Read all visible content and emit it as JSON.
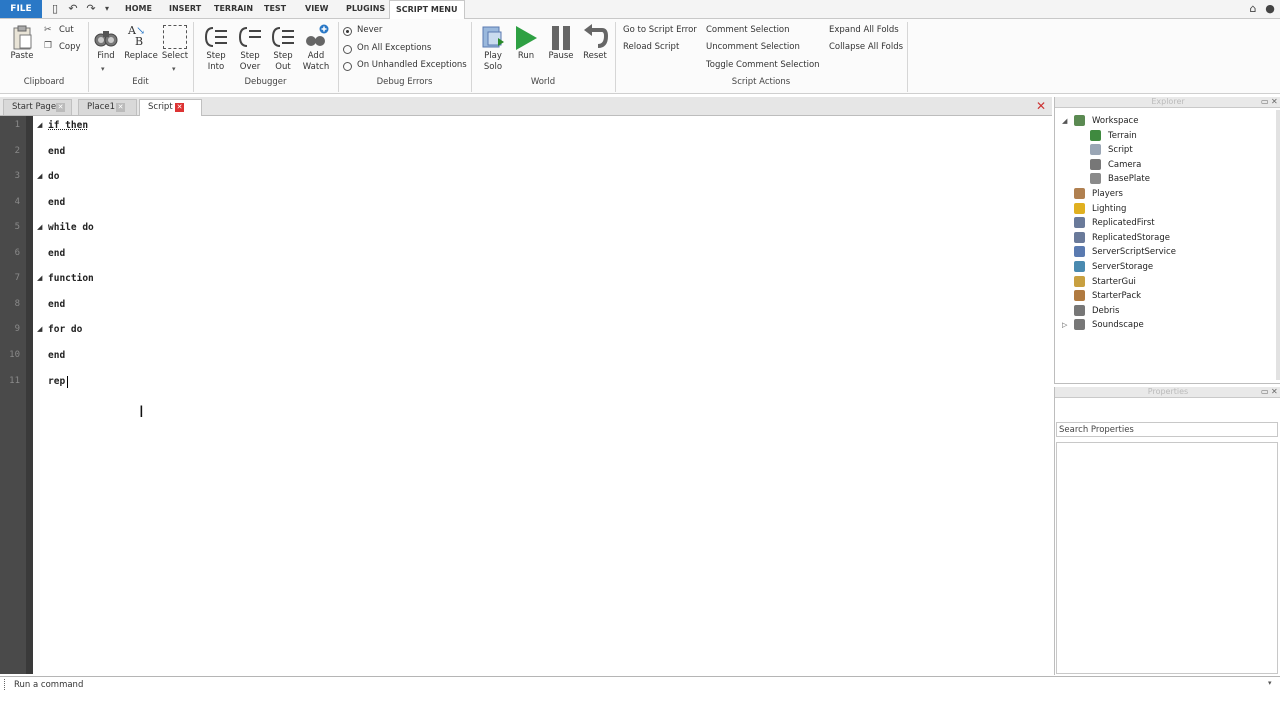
{
  "menubar": {
    "file": "FILE",
    "tabs": [
      "HOME",
      "INSERT",
      "TERRAIN",
      "TEST",
      "VIEW",
      "PLUGINS",
      "SCRIPT MENU"
    ]
  },
  "ribbon": {
    "clipboard": {
      "paste": "Paste",
      "cut": "Cut",
      "copy": "Copy",
      "label": "Clipboard"
    },
    "edit": {
      "find": "Find",
      "replace": "Replace",
      "select": "Select",
      "label": "Edit"
    },
    "debugger": {
      "step_into": "Step Into",
      "step_over": "Step Over",
      "step_out": "Step Out",
      "add_watch": "Add Watch",
      "label": "Debugger"
    },
    "debug_errors": {
      "options": [
        "Never",
        "On All Exceptions",
        "On Unhandled Exceptions"
      ],
      "selected": "Never",
      "label": "Debug Errors"
    },
    "world": {
      "play_solo": "Play Solo",
      "run": "Run",
      "pause": "Pause",
      "reset": "Reset",
      "label": "World"
    },
    "script_actions": {
      "goto_error": "Go to Script Error",
      "reload": "Reload Script",
      "comment": "Comment Selection",
      "uncomment": "Uncomment Selection",
      "toggle_comment": "Toggle Comment Selection",
      "expand": "Expand All Folds",
      "collapse": "Collapse All Folds",
      "label": "Script Actions"
    }
  },
  "doc_tabs": [
    "Start Page",
    "Place1",
    "Script"
  ],
  "code_lines": [
    {
      "n": "1",
      "text": "if then"
    },
    {
      "n": "2",
      "text": "end"
    },
    {
      "n": "3",
      "text": "do"
    },
    {
      "n": "4",
      "text": "end"
    },
    {
      "n": "5",
      "text": "while do"
    },
    {
      "n": "6",
      "text": "end"
    },
    {
      "n": "7",
      "text": "function"
    },
    {
      "n": "8",
      "text": "end"
    },
    {
      "n": "9",
      "text": "for do"
    },
    {
      "n": "10",
      "text": "end"
    },
    {
      "n": "11",
      "text": "rep"
    }
  ],
  "explorer": {
    "title": "Explorer",
    "items": [
      {
        "label": "Workspace",
        "indent": 0,
        "icon": "workspace-icon",
        "color": "#5b8a52"
      },
      {
        "label": "Terrain",
        "indent": 1,
        "icon": "terrain-icon",
        "color": "#3f8a3f"
      },
      {
        "label": "Script",
        "indent": 1,
        "icon": "script-icon",
        "color": "#9aa6b5"
      },
      {
        "label": "Camera",
        "indent": 1,
        "icon": "camera-icon",
        "color": "#777777"
      },
      {
        "label": "BasePlate",
        "indent": 1,
        "icon": "part-icon",
        "color": "#8a8a8a"
      },
      {
        "label": "Players",
        "indent": 0,
        "icon": "players-icon",
        "color": "#b08050"
      },
      {
        "label": "Lighting",
        "indent": 0,
        "icon": "lighting-icon",
        "color": "#e0b020"
      },
      {
        "label": "ReplicatedFirst",
        "indent": 0,
        "icon": "replicated-first-icon",
        "color": "#6a7a9a"
      },
      {
        "label": "ReplicatedStorage",
        "indent": 0,
        "icon": "replicated-storage-icon",
        "color": "#6a7a9a"
      },
      {
        "label": "ServerScriptService",
        "indent": 0,
        "icon": "server-script-service-icon",
        "color": "#5a7ab0"
      },
      {
        "label": "ServerStorage",
        "indent": 0,
        "icon": "server-storage-icon",
        "color": "#4a8ab0"
      },
      {
        "label": "StarterGui",
        "indent": 0,
        "icon": "starter-gui-icon",
        "color": "#c8a040"
      },
      {
        "label": "StarterPack",
        "indent": 0,
        "icon": "starter-pack-icon",
        "color": "#b07a40"
      },
      {
        "label": "Debris",
        "indent": 0,
        "icon": "debris-icon",
        "color": "#777777"
      },
      {
        "label": "Soundscape",
        "indent": 0,
        "icon": "soundscape-icon",
        "color": "#777777"
      }
    ]
  },
  "properties": {
    "title": "Properties",
    "search_placeholder": "Search Properties"
  },
  "command_bar": {
    "placeholder": "Run a command"
  }
}
